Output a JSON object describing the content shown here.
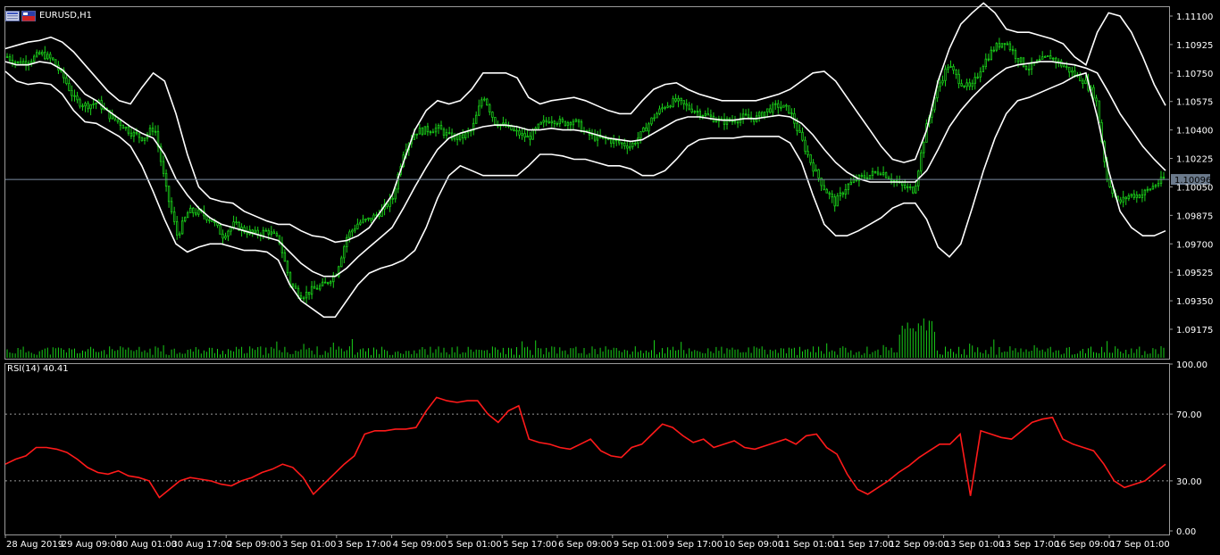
{
  "symbol": "EURUSD,H1",
  "icons": [
    "window-list-icon",
    "flag-icon"
  ],
  "colors": {
    "background": "#000000",
    "bull": "#19d119",
    "bands": "#ffffff",
    "rsi": "#ff1a1a",
    "frame": "#9a9a9a",
    "current_line": "#7d8ea3"
  },
  "rsi_label": "RSI(14) 40.41",
  "current_price_label": "1.10096",
  "price_ticks": [
    "1.11100",
    "1.10925",
    "1.10750",
    "1.10575",
    "1.10400",
    "1.10225",
    "1.10050",
    "1.09875",
    "1.09700",
    "1.09525",
    "1.09350",
    "1.09175"
  ],
  "rsi_ticks": [
    "100.00",
    "70.00",
    "30.00",
    "0.00"
  ],
  "time_labels": [
    "28 Aug 2019",
    "29 Aug 09:00",
    "30 Aug 01:00",
    "30 Aug 17:00",
    "2 Sep 09:00",
    "3 Sep 01:00",
    "3 Sep 17:00",
    "4 Sep 09:00",
    "5 Sep 01:00",
    "5 Sep 17:00",
    "6 Sep 09:00",
    "9 Sep 01:00",
    "9 Sep 17:00",
    "10 Sep 09:00",
    "11 Sep 01:00",
    "11 Sep 17:00",
    "12 Sep 09:00",
    "13 Sep 01:00",
    "13 Sep 17:00",
    "16 Sep 09:00",
    "17 Sep 01:00"
  ],
  "chart_data": [
    {
      "type": "line",
      "title": "EURUSD,H1",
      "ylim": [
        1.0908,
        1.1116
      ],
      "current_price": 1.10096,
      "grid": false,
      "series": [
        {
          "values": [
            1.1085,
            1.1081,
            1.1083,
            1.1087,
            1.1083,
            1.1072,
            1.1058,
            1.1055,
            1.1057,
            1.1049,
            1.1044,
            1.1038,
            1.1035,
            1.1042,
            1.1004,
            1.0975,
            1.099,
            1.0989,
            1.0985,
            1.0975,
            1.0982,
            1.0978,
            1.0976,
            1.0978,
            1.0972,
            1.0945,
            1.0938,
            1.0942,
            1.0945,
            1.0952,
            1.0975,
            1.0983,
            1.0985,
            1.099,
            1.0998,
            1.1028,
            1.1039,
            1.104,
            1.1041,
            1.1036,
            1.1035,
            1.104,
            1.1062,
            1.1045,
            1.1042,
            1.1038,
            1.1035,
            1.1043,
            1.1047,
            1.1044,
            1.1046,
            1.1038,
            1.1035,
            1.1034,
            1.1032,
            1.103,
            1.1038,
            1.1048,
            1.1055,
            1.1058,
            1.1054,
            1.1051,
            1.1048,
            1.1045,
            1.1046,
            1.1048,
            1.1047,
            1.1052,
            1.1055,
            1.1052,
            1.1035,
            1.1018,
            1.1005,
            1.0995,
            1.1005,
            1.101,
            1.1012,
            1.1015,
            1.101,
            1.1005,
            1.1003,
            1.104,
            1.1065,
            1.108,
            1.107,
            1.1065,
            1.108,
            1.109,
            1.1095,
            1.1085,
            1.1078,
            1.1082,
            1.1085,
            1.108,
            1.1075,
            1.107,
            1.106,
            1.101,
            1.0995,
            1.1,
            1.1,
            1.1005,
            1.101
          ]
        },
        {
          "values": [
            1.1082,
            1.108,
            1.108,
            1.1082,
            1.1081,
            1.1077,
            1.107,
            1.1062,
            1.1058,
            1.1052,
            1.1047,
            1.1042,
            1.1038,
            1.1035,
            1.1025,
            1.101,
            1.1,
            1.0992,
            1.0986,
            1.0982,
            1.098,
            1.0978,
            1.0976,
            1.0974,
            1.0972,
            1.0965,
            1.0958,
            1.0953,
            1.095,
            1.095,
            1.0955,
            1.0962,
            1.0968,
            1.0974,
            1.098,
            1.0992,
            1.1005,
            1.1017,
            1.1028,
            1.1035,
            1.1038,
            1.104,
            1.1042,
            1.1043,
            1.1043,
            1.1042,
            1.104,
            1.104,
            1.1041,
            1.104,
            1.104,
            1.1039,
            1.1037,
            1.1035,
            1.1034,
            1.1033,
            1.1034,
            1.1038,
            1.1042,
            1.1046,
            1.1048,
            1.1048,
            1.1047,
            1.1046,
            1.1046,
            1.1047,
            1.1047,
            1.1048,
            1.1049,
            1.1048,
            1.1044,
            1.1037,
            1.1028,
            1.102,
            1.1014,
            1.101,
            1.1008,
            1.1008,
            1.1008,
            1.1008,
            1.1008,
            1.1015,
            1.1028,
            1.1042,
            1.1052,
            1.106,
            1.1067,
            1.1073,
            1.1078,
            1.108,
            1.1081,
            1.1082,
            1.1082,
            1.1081,
            1.108,
            1.1078,
            1.1075,
            1.1063,
            1.105,
            1.104,
            1.103,
            1.1022,
            1.1015
          ]
        },
        {
          "values": [
            1.109,
            1.1092,
            1.1094,
            1.1095,
            1.1097,
            1.1094,
            1.1088,
            1.108,
            1.1072,
            1.1064,
            1.1058,
            1.1056,
            1.1066,
            1.1075,
            1.107,
            1.105,
            1.1025,
            1.1005,
            1.0998,
            1.0996,
            1.0995,
            1.099,
            1.0987,
            1.0984,
            1.0982,
            1.0982,
            1.0978,
            1.0975,
            1.0974,
            1.0971,
            1.0972,
            1.0975,
            1.098,
            1.099,
            1.1,
            1.102,
            1.104,
            1.1052,
            1.1058,
            1.1056,
            1.1058,
            1.1065,
            1.1075,
            1.1075,
            1.1075,
            1.1072,
            1.106,
            1.1056,
            1.1058,
            1.1059,
            1.106,
            1.1058,
            1.1055,
            1.1052,
            1.105,
            1.105,
            1.1058,
            1.1065,
            1.1068,
            1.1069,
            1.1065,
            1.1062,
            1.106,
            1.1058,
            1.1058,
            1.1058,
            1.1058,
            1.106,
            1.1062,
            1.1065,
            1.107,
            1.1075,
            1.1076,
            1.107,
            1.106,
            1.105,
            1.104,
            1.103,
            1.1022,
            1.102,
            1.1022,
            1.104,
            1.107,
            1.109,
            1.1105,
            1.1112,
            1.1118,
            1.1112,
            1.1102,
            1.11,
            1.11,
            1.1098,
            1.1096,
            1.1093,
            1.1085,
            1.108,
            1.11,
            1.1112,
            1.111,
            1.11,
            1.1085,
            1.1068,
            1.1055
          ]
        },
        {
          "values": [
            1.1076,
            1.107,
            1.1068,
            1.1069,
            1.1068,
            1.1062,
            1.1052,
            1.1045,
            1.1044,
            1.104,
            1.1036,
            1.103,
            1.1018,
            1.1002,
            1.0985,
            1.097,
            1.0965,
            1.0968,
            1.097,
            1.097,
            1.0968,
            1.0966,
            1.0966,
            1.0965,
            1.096,
            1.0945,
            1.0935,
            1.093,
            1.0925,
            1.0925,
            1.0935,
            1.0945,
            1.0952,
            1.0955,
            1.0957,
            1.096,
            1.0966,
            1.098,
            1.0998,
            1.1012,
            1.1018,
            1.1015,
            1.1012,
            1.1012,
            1.1012,
            1.1012,
            1.1018,
            1.1025,
            1.1025,
            1.1024,
            1.1022,
            1.1022,
            1.102,
            1.1018,
            1.1018,
            1.1016,
            1.1012,
            1.1012,
            1.1015,
            1.1022,
            1.103,
            1.1034,
            1.1035,
            1.1035,
            1.1035,
            1.1036,
            1.1036,
            1.1036,
            1.1036,
            1.1032,
            1.102,
            1.1,
            1.0982,
            1.0975,
            1.0975,
            1.0978,
            1.0982,
            1.0986,
            1.0992,
            1.0995,
            1.0995,
            1.0985,
            1.0968,
            1.0962,
            1.097,
            1.0992,
            1.1015,
            1.1035,
            1.105,
            1.1058,
            1.106,
            1.1063,
            1.1066,
            1.1069,
            1.1073,
            1.1075,
            1.1048,
            1.1015,
            1.099,
            1.098,
            1.0975,
            1.0975,
            1.0978
          ]
        }
      ]
    },
    {
      "type": "line",
      "title": "RSI(14) 40.41",
      "ylim": [
        0,
        100
      ],
      "levels": [
        70,
        30
      ],
      "series": [
        {
          "values": [
            40,
            43,
            45,
            50,
            50,
            49,
            47,
            43,
            38,
            35,
            34,
            36,
            33,
            32,
            30,
            20,
            25,
            30,
            32,
            31,
            30,
            28,
            27,
            30,
            32,
            35,
            37,
            40,
            38,
            32,
            22,
            28,
            34,
            40,
            45,
            58,
            60,
            60,
            61,
            61,
            62,
            72,
            80,
            78,
            77,
            78,
            78,
            70,
            65,
            72,
            75,
            55,
            53,
            52,
            50,
            49,
            52,
            55,
            48,
            45,
            44,
            50,
            52,
            58,
            64,
            62,
            57,
            53,
            55,
            50,
            52,
            54,
            50,
            49,
            51,
            53,
            55,
            52,
            57,
            58,
            50,
            46,
            34,
            25,
            22,
            26,
            30,
            35,
            39,
            44,
            48,
            52,
            52,
            58,
            21,
            60,
            58,
            56,
            55,
            60,
            65,
            67,
            68,
            55,
            52,
            50,
            48,
            40,
            30,
            26,
            28,
            30,
            35,
            40
          ]
        }
      ]
    }
  ]
}
